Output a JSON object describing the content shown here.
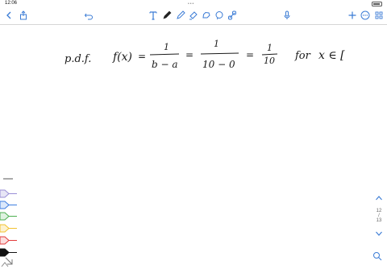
{
  "status_bar": {
    "time": "12:06",
    "dots": "•••"
  },
  "toolbar": {
    "left": [
      {
        "name": "back-chevron-icon"
      },
      {
        "name": "share-icon"
      },
      {
        "name": "undo-icon"
      }
    ],
    "tools": [
      {
        "name": "text-tool-icon"
      },
      {
        "name": "pen-tool-icon"
      },
      {
        "name": "eraser-tool-icon"
      },
      {
        "name": "highlighter-tool-icon"
      },
      {
        "name": "lasso-tool-icon"
      },
      {
        "name": "shapes-tool-icon"
      },
      {
        "name": "link-tool-icon"
      }
    ],
    "right": [
      {
        "name": "microphone-icon"
      },
      {
        "name": "add-page-icon"
      },
      {
        "name": "more-icon"
      },
      {
        "name": "pages-grid-icon"
      }
    ]
  },
  "note": {
    "label": "p.d.f.",
    "function": "f(x)",
    "equals": "=",
    "frac1_num": "1",
    "frac1_den": "b − a",
    "frac2_num": "1",
    "frac2_den": "10 − 0",
    "frac3_num": "1",
    "frac3_den": "10",
    "for_text": "for",
    "domain_text": "x ∈ ["
  },
  "pens": [
    {
      "name": "pen-lavender",
      "color": "#9a8fd6"
    },
    {
      "name": "pen-blue",
      "color": "#3d7de0"
    },
    {
      "name": "pen-green",
      "color": "#4caf50"
    },
    {
      "name": "pen-yellow",
      "color": "#f2c230"
    },
    {
      "name": "pen-red",
      "color": "#e23b3b"
    },
    {
      "name": "pen-black",
      "color": "#111111"
    }
  ],
  "page_nav": {
    "current": "12",
    "separator": "/",
    "total": "13"
  }
}
